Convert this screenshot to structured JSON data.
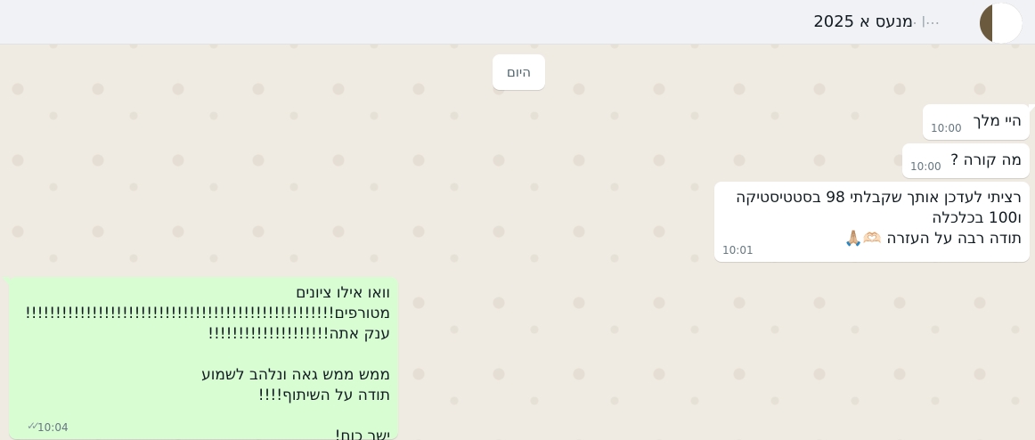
{
  "header": {
    "title": "מנעס א 2025",
    "contact_name": "…ן ..",
    "avatar_icon": "contact-photo"
  },
  "date_divider": "היום",
  "messages": [
    {
      "direction": "incoming",
      "text": "היי מלך",
      "time": "10:00"
    },
    {
      "direction": "incoming",
      "text": "מה קורה ?",
      "time": "10:00"
    },
    {
      "direction": "incoming",
      "text": "רציתי לעדכן אותך שקבלתי 98 בסטטיסטיקה\nו100 בכלכלה\nתודה רבה על העזרה 🫶🏻🙏🏼",
      "time": "10:01"
    },
    {
      "direction": "outgoing",
      "text": "וואו אילו ציונים מטורפים!!!!!!!!!!!!!!!!!!!!!!!!!!!!!!!!!!!!!!!!!!!!!!!!!!!\nענק אתה!!!!!!!!!!!!!!!!!!!!\n\nממש ממש גאה ונלהב לשמוע\nתודה על השיתוף!!!!\n\nישר כוח!",
      "time": "10:04",
      "status": "read"
    }
  ],
  "colors": {
    "chat_bg": "#efeae2",
    "incoming_bubble": "#ffffff",
    "outgoing_bubble": "#d9fdd3",
    "header_bg": "#f0f2f5"
  }
}
